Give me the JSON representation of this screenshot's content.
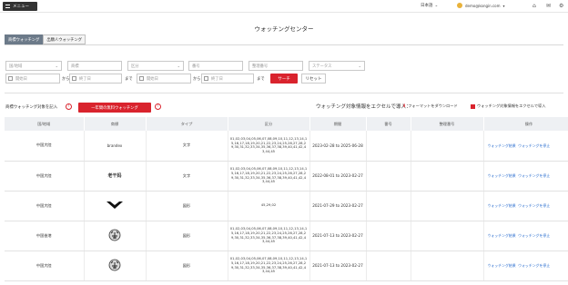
{
  "topbar": {
    "menu_label": "メニュー",
    "language": "日本語",
    "user_email": "demo@kongin.com"
  },
  "page": {
    "title": "ウォッチングセンター"
  },
  "tabs": [
    {
      "label": "商標ウォッチング"
    },
    {
      "label": "出願人ウォッチング"
    }
  ],
  "filters": {
    "country_placeholder": "国/地域",
    "mark_placeholder": "商標",
    "class_placeholder": "区分",
    "app_no_placeholder": "番号",
    "mgmt_no_placeholder": "整理番号",
    "status_placeholder": "ステータス",
    "start_placeholder_1": "開始日",
    "end_placeholder_1": "終了日",
    "start_placeholder_2": "開始日",
    "end_placeholder_2": "終了日",
    "from_text": "から",
    "until_text": "まで",
    "search_label": "サーチ",
    "reset_label": "リセット"
  },
  "actions": {
    "bulk_label": "商標ウォッチング対象を記入",
    "new_watch_label": "一年間の無料ウォッチング",
    "excel_label": "ウォッチング対象情報をエクセルで導入：",
    "download_label": "フォーマットをダウンロード",
    "upload_label": "ウォッチング対象情報をエクセルで導入"
  },
  "table": {
    "headers": [
      "国/地域",
      "商標",
      "タイプ",
      "区分",
      "期間",
      "番号",
      "整理番号",
      "操作"
    ],
    "rows": [
      {
        "country": "中国大陸",
        "mark": "brandex",
        "type": "文字",
        "classes": "01,02,03,04,05,06,07,08,09,10,11,12,13,14,15,16,17,18,19,20,21,22,23,24,25,26,27,28,29,30,31,32,33,34,35,36,37,38,39,40,41,42,43,44,45",
        "period": "2023-02-28 to 2025-06-28",
        "number": "",
        "mgmt": "",
        "op1": "ウォッチング結果",
        "op2": "ウォッチングを停止"
      },
      {
        "country": "中国大陸",
        "mark": "老干妈",
        "type": "文字",
        "classes": "01,02,03,04,05,06,07,08,09,10,11,12,13,14,15,16,17,18,19,20,21,22,23,24,25,26,27,28,29,30,31,32,33,34,35,36,37,38,39,40,41,42,43,44,45",
        "period": "2022-08-01 to 2023-02-27",
        "number": "",
        "mgmt": "",
        "op1": "ウォッチング結果",
        "op2": "ウォッチングを停止"
      },
      {
        "country": "中国大陸",
        "mark": "",
        "type": "図形",
        "classes": "45,29,02",
        "period": "2021-07-29 to 2023-02-27",
        "number": "",
        "mgmt": "",
        "op1": "ウォッチング結果",
        "op2": "ウォッチングを停止"
      },
      {
        "country": "中国香港",
        "mark": "",
        "type": "図形",
        "classes": "01,02,03,04,05,06,07,08,09,10,11,12,13,14,15,16,17,18,19,20,21,22,23,24,25,26,27,28,29,30,31,32,33,34,35,36,37,38,39,40,41,42,43,44,45",
        "period": "2021-07-13 to 2023-02-27",
        "number": "",
        "mgmt": "",
        "op1": "ウォッチング結果",
        "op2": "ウォッチングを停止"
      },
      {
        "country": "中国大陸",
        "mark": "",
        "type": "図形",
        "classes": "01,02,03,04,05,06,07,08,09,10,11,12,13,14,15,16,17,18,19,20,21,22,23,24,25,26,27,28,29,30,31,32,33,34,35,36,37,38,39,40,41,42,43,44,45",
        "period": "2021-07-13 to 2023-02-27",
        "number": "",
        "mgmt": "",
        "op1": "ウォッチング結果",
        "op2": "ウォッチングを停止"
      }
    ]
  }
}
